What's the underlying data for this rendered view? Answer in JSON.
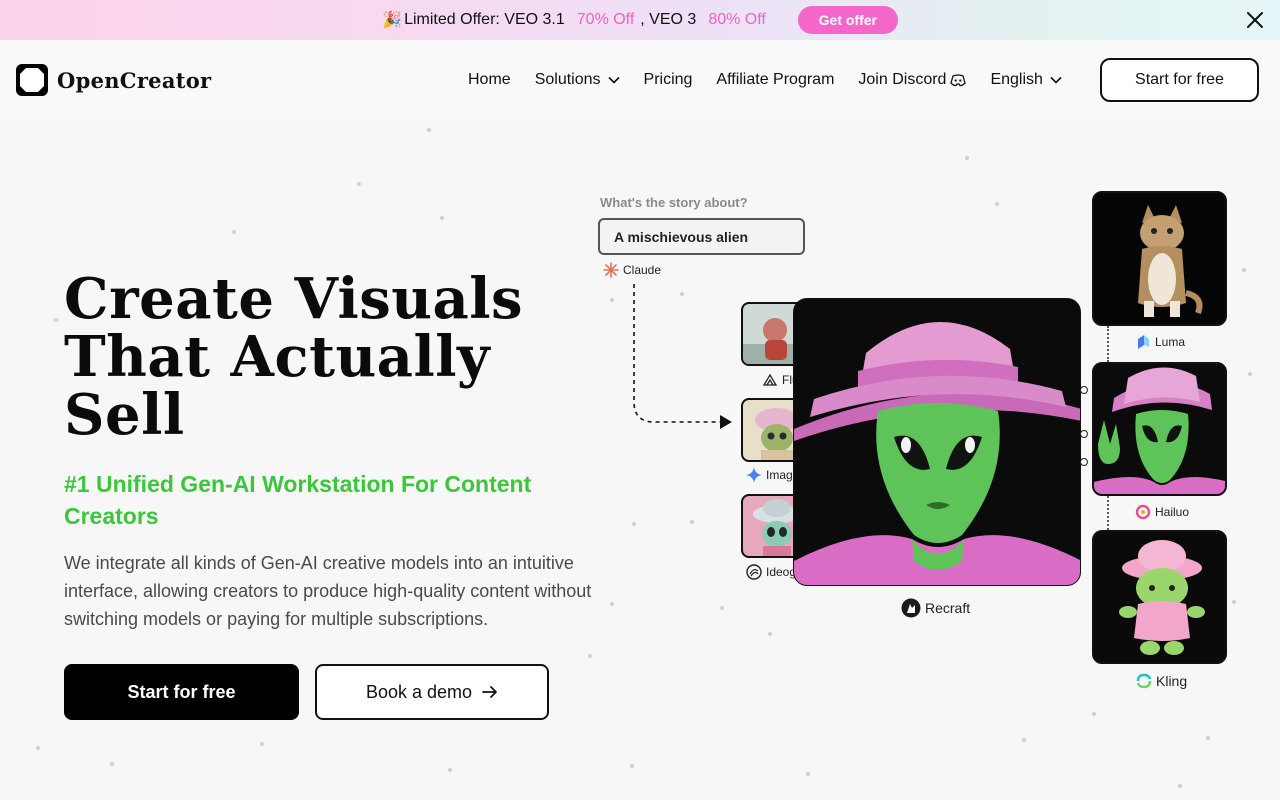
{
  "promo": {
    "emoji": "🎉",
    "text_prefix": "Limited Offer: VEO 3.1",
    "discount_1": "70% Off",
    "text_mid": ", VEO 3",
    "discount_2": "80% Off",
    "cta": "Get offer"
  },
  "header": {
    "brand": "OpenCreator",
    "nav": {
      "home": "Home",
      "solutions": "Solutions",
      "pricing": "Pricing",
      "affiliate": "Affiliate Program",
      "discord": "Join Discord",
      "language": "English"
    },
    "cta": "Start for free"
  },
  "hero": {
    "title_line1": "Create Visuals",
    "title_line2": "That Actually",
    "title_line3": "Sell",
    "subtitle": "#1 Unified Gen-AI Workstation For Content Creators",
    "description": "We integrate all kinds of Gen-AI creative models into an intuitive interface, allowing creators to produce high-quality content without switching models or paying for multiple subscriptions.",
    "primary_cta": "Start for free",
    "secondary_cta": "Book a demo"
  },
  "visual": {
    "story_label": "What's the story about?",
    "story_value": "A mischievous alien",
    "models": {
      "claude": "Claude",
      "flux": "Flux",
      "imagen": "Image",
      "ideogram": "Ideog",
      "recraft": "Recraft",
      "luma": "Luma",
      "hailuo": "Hailuo",
      "kling": "Kling"
    }
  },
  "colors": {
    "accent_green": "#3bc63b",
    "promo_pink": "#f466c9",
    "text_dark": "#111111"
  }
}
